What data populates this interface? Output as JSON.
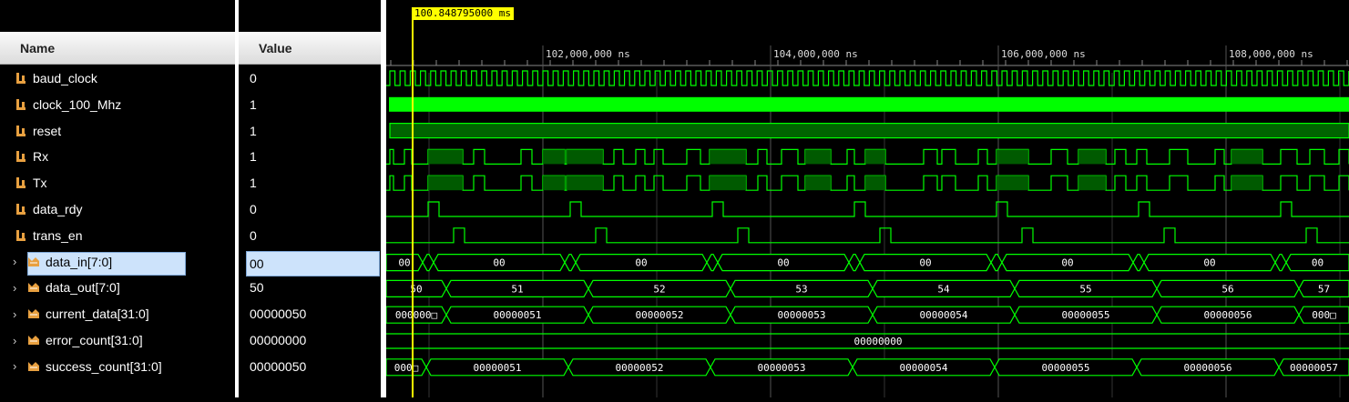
{
  "columns": {
    "name": "Name",
    "value": "Value"
  },
  "cursor_time": "100.848795000 ms",
  "time_ticks": [
    "102,000,000 ns",
    "104,000,000 ns",
    "106,000,000 ns",
    "108,000,000 ns"
  ],
  "signals": [
    {
      "name": "baud_clock",
      "value": "0",
      "type": "bit"
    },
    {
      "name": "clock_100_Mhz",
      "value": "1",
      "type": "bit"
    },
    {
      "name": "reset",
      "value": "1",
      "type": "bit"
    },
    {
      "name": "Rx",
      "value": "1",
      "type": "bit"
    },
    {
      "name": "Tx",
      "value": "1",
      "type": "bit"
    },
    {
      "name": "data_rdy",
      "value": "0",
      "type": "bit"
    },
    {
      "name": "trans_en",
      "value": "0",
      "type": "bit"
    },
    {
      "name": "data_in[7:0]",
      "value": "00",
      "type": "bus",
      "selected": true
    },
    {
      "name": "data_out[7:0]",
      "value": "50",
      "type": "bus"
    },
    {
      "name": "current_data[31:0]",
      "value": "00000050",
      "type": "bus"
    },
    {
      "name": "error_count[31:0]",
      "value": "00000000",
      "type": "bus"
    },
    {
      "name": "success_count[31:0]",
      "value": "00000050",
      "type": "bus"
    }
  ],
  "bus_waves": {
    "data_in": [
      "00",
      "00",
      "00",
      "00",
      "00",
      "00",
      "00",
      "00"
    ],
    "data_out": [
      "50",
      "51",
      "52",
      "53",
      "54",
      "55",
      "56",
      "57"
    ],
    "current_data": [
      "000000□",
      "00000051",
      "00000052",
      "00000053",
      "00000054",
      "00000055",
      "00000056",
      "000□"
    ],
    "error_count": [
      "00000000"
    ],
    "success_count": [
      "000□",
      "00000051",
      "00000052",
      "00000053",
      "00000054",
      "00000055",
      "00000056",
      "00000057"
    ]
  },
  "colors": {
    "wave": "#00ff00",
    "bus_fill": "#006400",
    "cursor": "#ffff00",
    "selected": "#cde3fb"
  },
  "icons": {
    "bit": "bit-signal-icon",
    "bus": "bus-signal-icon"
  }
}
